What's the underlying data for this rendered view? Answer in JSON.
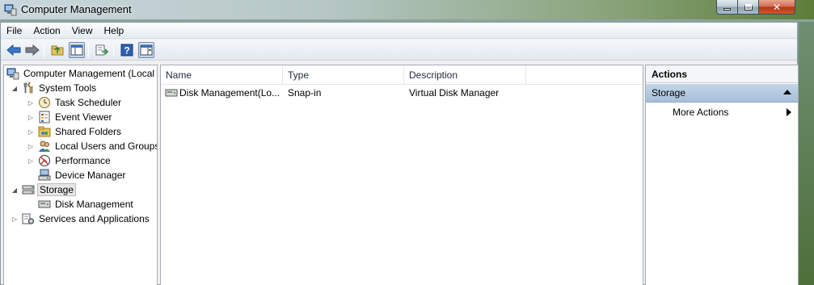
{
  "window": {
    "title": "Computer Management"
  },
  "menu": [
    {
      "label": "File"
    },
    {
      "label": "Action"
    },
    {
      "label": "View"
    },
    {
      "label": "Help"
    }
  ],
  "tree": {
    "root": "Computer Management (Local",
    "system_tools": "System Tools",
    "task_scheduler": "Task Scheduler",
    "event_viewer": "Event Viewer",
    "shared_folders": "Shared Folders",
    "local_users": "Local Users and Groups",
    "performance": "Performance",
    "device_manager": "Device Manager",
    "storage": "Storage",
    "disk_management": "Disk Management",
    "services": "Services and Applications"
  },
  "list": {
    "columns": [
      "Name",
      "Type",
      "Description"
    ],
    "rows": [
      {
        "name": "Disk Management(Lo...",
        "type": "Snap-in",
        "description": "Virtual Disk Manager"
      }
    ]
  },
  "actions": {
    "header": "Actions",
    "section": "Storage",
    "more": "More Actions"
  },
  "colors": {
    "selection_section": "#b5cae0",
    "titlebar_glass": "#8aa37a"
  }
}
